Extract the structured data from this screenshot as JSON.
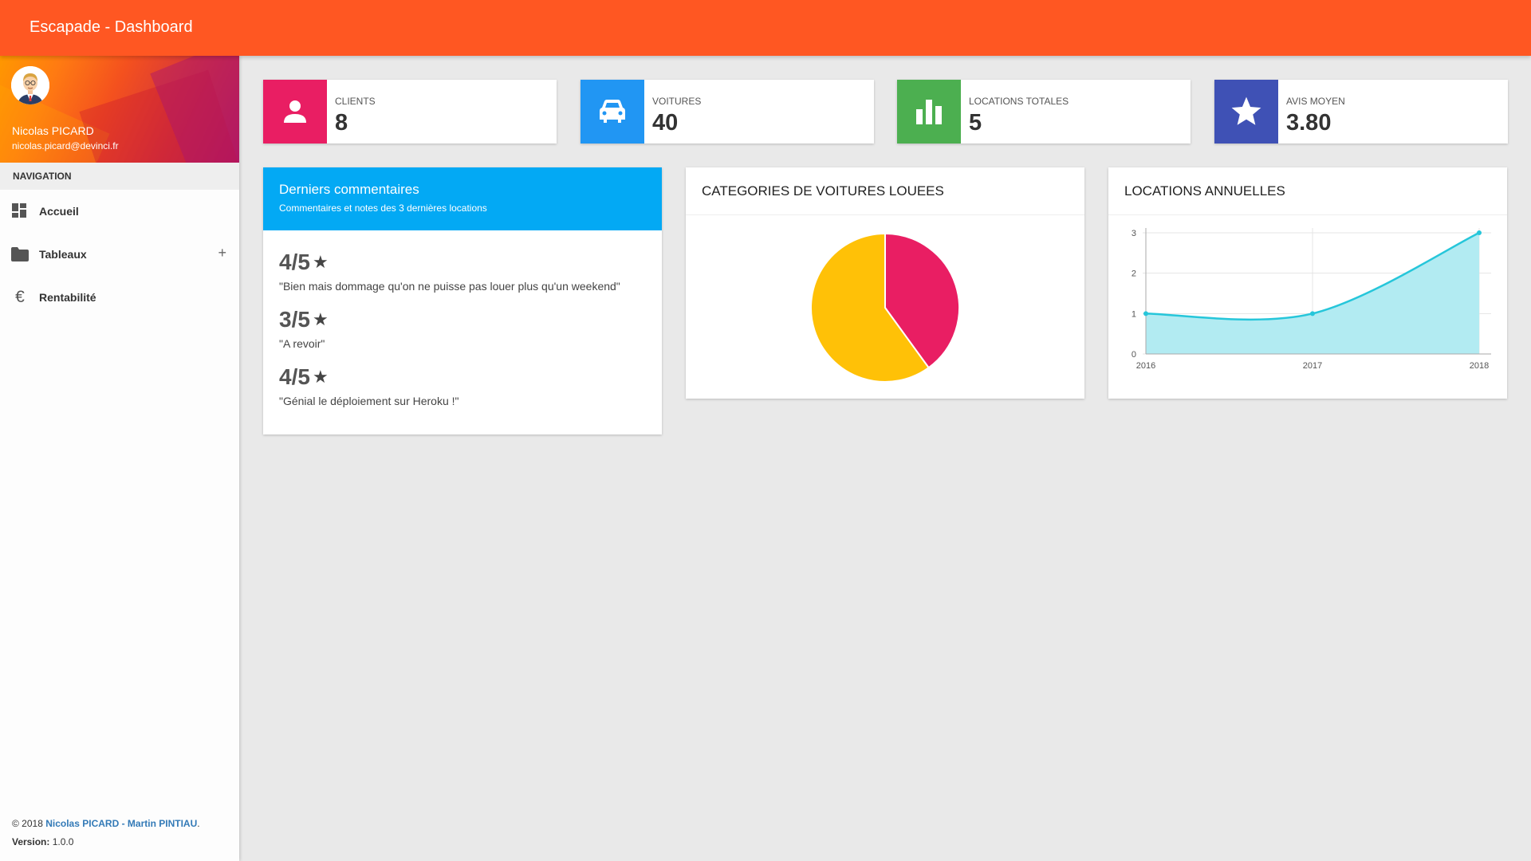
{
  "app": {
    "title": "Escapade - Dashboard"
  },
  "user": {
    "name": "Nicolas PICARD",
    "email": "nicolas.picard@devinci.fr"
  },
  "nav": {
    "header": "NAVIGATION",
    "items": [
      {
        "label": "Accueil",
        "icon": "dashboard-icon"
      },
      {
        "label": "Tableaux",
        "icon": "folder-icon",
        "expand": "+"
      },
      {
        "label": "Rentabilité",
        "icon": "euro-icon"
      }
    ]
  },
  "footer": {
    "copyright": "© 2018 ",
    "authors": "Nicolas PICARD - Martin PINTIAU",
    "period": ".",
    "version_label": "Version:",
    "version": " 1.0.0"
  },
  "stats": [
    {
      "label": "CLIENTS",
      "value": "8",
      "icon": "person-icon",
      "color": "#e91e63"
    },
    {
      "label": "VOITURES",
      "value": "40",
      "icon": "car-icon",
      "color": "#2196f3"
    },
    {
      "label": "LOCATIONS TOTALES",
      "value": "5",
      "icon": "bar-chart-icon",
      "color": "#4caf50"
    },
    {
      "label": "AVIS MOYEN",
      "value": "3.80",
      "icon": "star-icon",
      "color": "#3f51b5"
    }
  ],
  "comments": {
    "title": "Derniers commentaires",
    "subtitle": "Commentaires et notes des 3 dernières locations",
    "items": [
      {
        "rating": "4/5",
        "text": "\"Bien mais dommage qu'on ne puisse pas louer plus qu'un weekend\""
      },
      {
        "rating": "3/5",
        "text": "\"A revoir\""
      },
      {
        "rating": "4/5",
        "text": "\"Génial le déploiement sur Heroku !\""
      }
    ]
  },
  "categories_panel": {
    "title": "CATEGORIES DE VOITURES LOUEES"
  },
  "annual_panel": {
    "title": "LOCATIONS ANNUELLES"
  },
  "chart_data": [
    {
      "type": "pie",
      "title": "CATEGORIES DE VOITURES LOUEES",
      "values": [
        2,
        3
      ],
      "colors": [
        "#e91e63",
        "#ffc107"
      ]
    },
    {
      "type": "area",
      "title": "LOCATIONS ANNUELLES",
      "x": [
        "2016",
        "2017",
        "2018"
      ],
      "series": [
        {
          "values": [
            1,
            1,
            3
          ]
        }
      ],
      "ylim": [
        0,
        3
      ],
      "yticks": [
        "0",
        "1",
        "2",
        "3"
      ],
      "color": "#26c6da",
      "fill": "#b2ebf2",
      "grid": true
    }
  ]
}
